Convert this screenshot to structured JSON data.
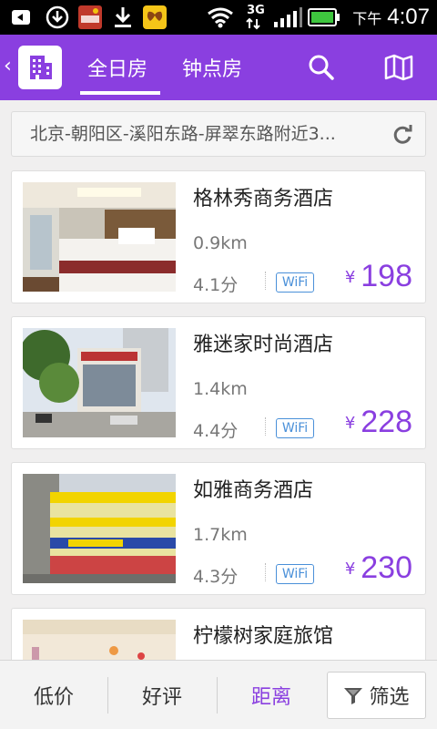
{
  "status_bar": {
    "ampm": "下午",
    "time": "4:07",
    "network": "3G"
  },
  "header": {
    "tabs": [
      {
        "label": "全日房",
        "active": true
      },
      {
        "label": "钟点房",
        "active": false
      }
    ],
    "accent_color": "#8a3fe0"
  },
  "address": {
    "text": "北京-朝阳区-溪阳东路-屏翠东路附近3..."
  },
  "hotels": [
    {
      "name": "格林秀商务酒店",
      "distance": "0.9km",
      "rating": "4.1分",
      "wifi": "WiFi",
      "currency": "¥",
      "price": "198"
    },
    {
      "name": "雅迷家时尚酒店",
      "distance": "1.4km",
      "rating": "4.4分",
      "wifi": "WiFi",
      "currency": "¥",
      "price": "228"
    },
    {
      "name": "如雅商务酒店",
      "distance": "1.7km",
      "rating": "4.3分",
      "wifi": "WiFi",
      "currency": "¥",
      "price": "230"
    },
    {
      "name": "柠檬树家庭旅馆"
    }
  ],
  "bottom_bar": {
    "sort_low_price": "低价",
    "sort_good_review": "好评",
    "sort_distance": "距离",
    "filter": "筛选",
    "active": "距离"
  }
}
